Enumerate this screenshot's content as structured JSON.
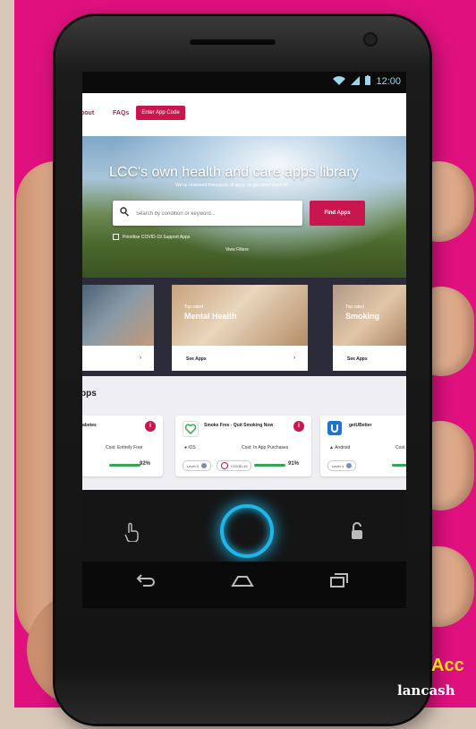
{
  "status_bar": {
    "time": "12:00",
    "wifi_icon": "wifi-icon",
    "signal_icon": "signal-icon",
    "battery_icon": "battery-icon"
  },
  "nav": {
    "about": "bout",
    "faqs": "FAQs",
    "enter_code": "Enter App Code"
  },
  "hero": {
    "title": "LCC's own health and care apps library",
    "subtitle": "We've reviewed thousands of apps, so you don't have to!",
    "search_placeholder": "Search by condition or keyword...",
    "find_button": "Find Apps",
    "prioritise_label": "Prioritise COVID-19 Support Apps",
    "view_filters": "View Filters"
  },
  "categories": [
    {
      "tag": "",
      "title": "",
      "see": "",
      "arrow": "›"
    },
    {
      "tag": "Top rated",
      "title": "Mental Health",
      "see": "See Apps",
      "arrow": "›"
    },
    {
      "tag": "Top rated",
      "title": "Smoking",
      "see": "See Apps",
      "arrow": ""
    }
  ],
  "apps": {
    "heading": "pps",
    "cards": [
      {
        "name": "abetes",
        "os": "",
        "cost": "Cost: Entirely Free",
        "level": "",
        "covid": "",
        "score": "92%",
        "score_value": 92
      },
      {
        "name": "Smoke Free - Quit Smoking Now",
        "os": "iOS",
        "cost": "Cost: In App Purchases",
        "level": "Level 3",
        "covid": "COVID-19",
        "score": "91%",
        "score_value": 91
      },
      {
        "name": "getUBetter",
        "os": "Android",
        "cost": "Cost",
        "level": "Level 4",
        "covid": "",
        "score": "",
        "score_value": 0
      }
    ]
  },
  "promo": {
    "line1": "Acc",
    "line2": "lancash"
  },
  "colors": {
    "brand": "#c8174e",
    "background": "#e0117f",
    "ring": "#1fb6e8"
  }
}
